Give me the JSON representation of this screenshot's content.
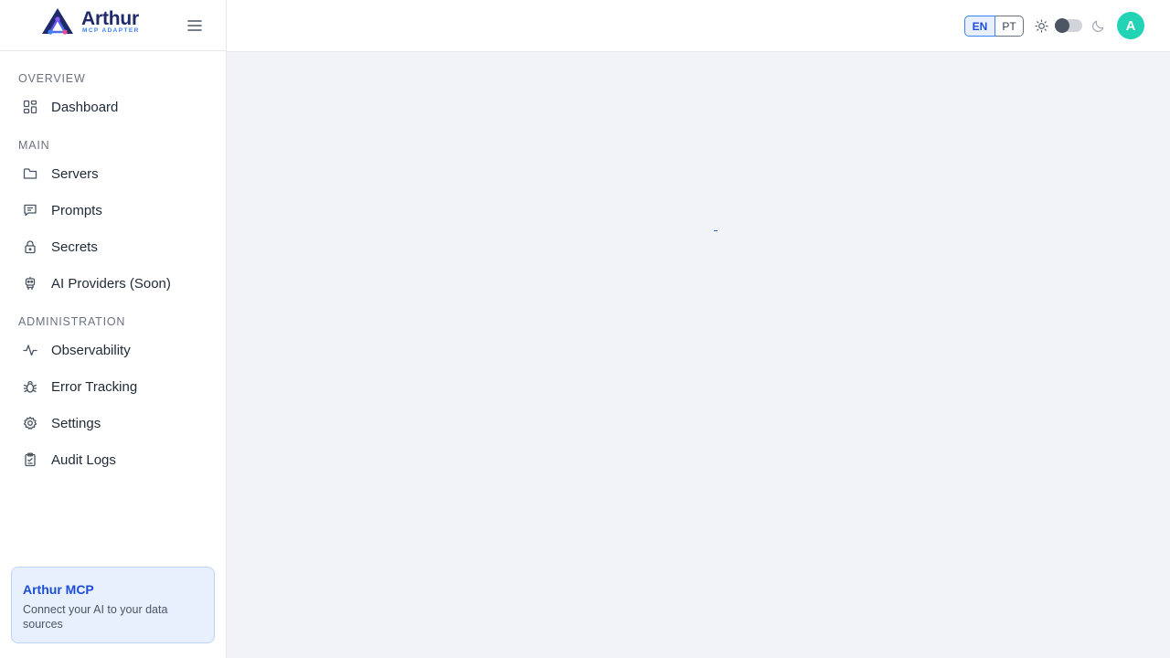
{
  "brand": {
    "name": "Arthur",
    "subtitle": "MCP ADAPTER"
  },
  "sidebar": {
    "sections": [
      {
        "title": "OVERVIEW",
        "items": [
          {
            "label": "Dashboard",
            "icon": "dashboard-icon"
          }
        ]
      },
      {
        "title": "MAIN",
        "items": [
          {
            "label": "Servers",
            "icon": "folder-icon"
          },
          {
            "label": "Prompts",
            "icon": "message-icon"
          },
          {
            "label": "Secrets",
            "icon": "lock-icon"
          },
          {
            "label": "AI Providers (Soon)",
            "icon": "robot-icon"
          }
        ]
      },
      {
        "title": "ADMINISTRATION",
        "items": [
          {
            "label": "Observability",
            "icon": "activity-icon"
          },
          {
            "label": "Error Tracking",
            "icon": "bug-icon"
          },
          {
            "label": "Settings",
            "icon": "gear-icon"
          },
          {
            "label": "Audit Logs",
            "icon": "clipboard-icon"
          }
        ]
      }
    ],
    "promo": {
      "title": "Arthur MCP",
      "text": "Connect your AI to your data sources"
    }
  },
  "header": {
    "languages": [
      "EN",
      "PT"
    ],
    "active_language": "EN",
    "theme_toggle": {
      "state": "light"
    },
    "avatar_initial": "A"
  },
  "colors": {
    "accent": "#3b82f6",
    "brand_dark": "#1f2a6b",
    "avatar": "#22d3b6",
    "background": "#f1f3f6"
  }
}
